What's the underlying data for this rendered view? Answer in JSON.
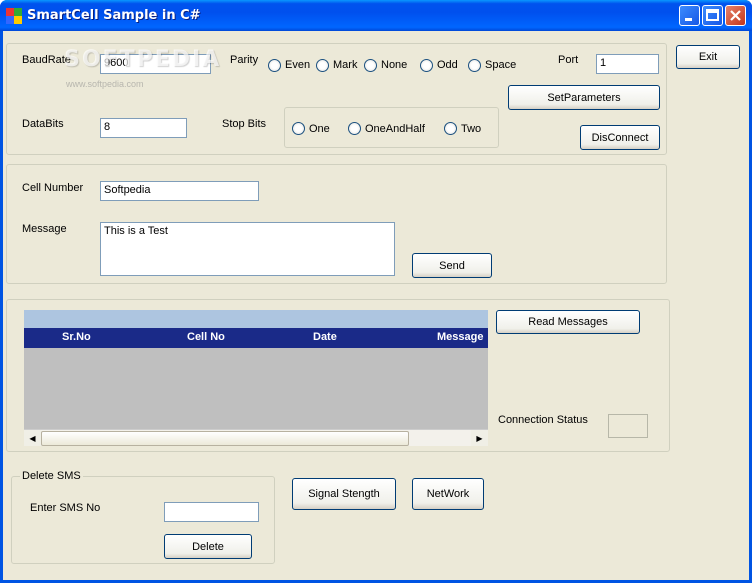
{
  "window": {
    "title": "SmartCell Sample in C#"
  },
  "watermark": {
    "text": "SOFTPEDIA",
    "sub": "www.softpedia.com"
  },
  "settings": {
    "baudrate_label": "BaudRate",
    "baudrate_value": "9600",
    "parity_label": "Parity",
    "parity_options": [
      "Even",
      "Mark",
      "None",
      "Odd",
      "Space"
    ],
    "port_label": "Port",
    "port_value": "1",
    "databits_label": "DataBits",
    "databits_value": "8",
    "stopbits_label": "Stop Bits",
    "stopbits_options": [
      "One",
      "OneAndHalf",
      "Two"
    ],
    "setparams_label": "SetParameters",
    "disconnect_label": "DisConnect"
  },
  "exit_label": "Exit",
  "message_panel": {
    "cell_label": "Cell Number",
    "cell_value": "Softpedia",
    "message_label": "Message",
    "message_value": "This is a Test",
    "send_label": "Send"
  },
  "messages_panel": {
    "columns": [
      "Sr.No",
      "Cell No",
      "Date",
      "Message"
    ],
    "read_label": "Read Messages",
    "status_label": "Connection Status"
  },
  "delete_panel": {
    "legend": "Delete SMS",
    "enter_label": "Enter SMS No",
    "delete_label": "Delete"
  },
  "signal_label": "Signal Stength",
  "network_label": "NetWork"
}
